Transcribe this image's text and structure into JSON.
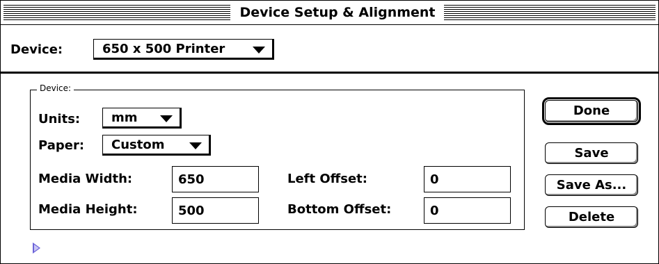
{
  "window": {
    "title": "Device Setup & Alignment"
  },
  "device_selector": {
    "label": "Device:",
    "value": "650 x 500 Printer"
  },
  "group": {
    "label": "Device:",
    "units": {
      "label": "Units:",
      "value": "mm"
    },
    "paper": {
      "label": "Paper:",
      "value": "Custom"
    },
    "media_width": {
      "label": "Media Width:",
      "value": "650"
    },
    "media_height": {
      "label": "Media Height:",
      "value": "500"
    },
    "left_offset": {
      "label": "Left Offset:",
      "value": "0"
    },
    "bottom_offset": {
      "label": "Bottom Offset:",
      "value": "0"
    }
  },
  "buttons": {
    "done": "Done",
    "save": "Save",
    "save_as": "Save As...",
    "delete": "Delete"
  },
  "colors": {
    "disclosure_triangle": "#6b63d8"
  },
  "icons": {
    "popup_arrow": "triangle-down-icon",
    "disclosure": "disclosure-triangle-icon"
  }
}
